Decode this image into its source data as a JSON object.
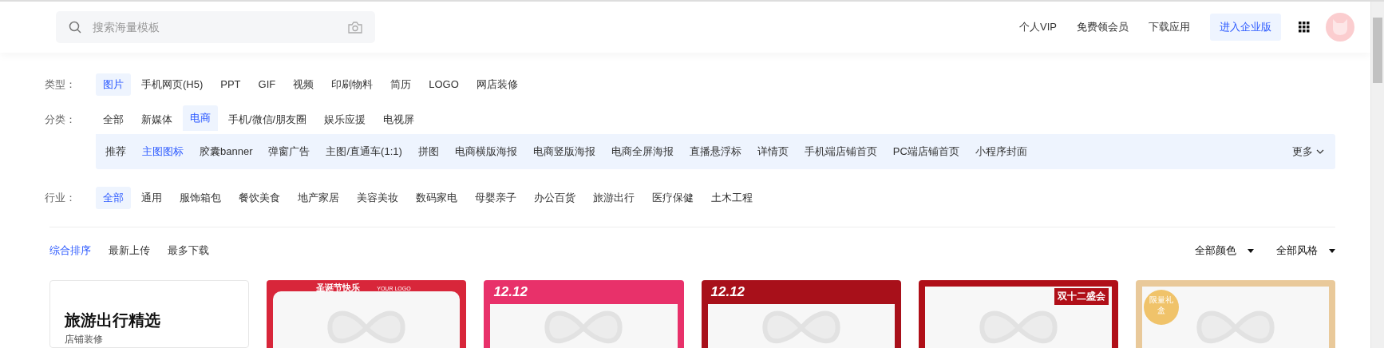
{
  "search": {
    "placeholder": "搜索海量模板"
  },
  "nav_links": [
    "个人VIP",
    "免费领会员",
    "下载应用"
  ],
  "enterprise_button": "进入企业版",
  "filters": [
    {
      "label": "类型：",
      "options": [
        {
          "text": "图片",
          "selected": true
        },
        {
          "text": "手机网页(H5)",
          "selected": false
        },
        {
          "text": "PPT",
          "selected": false
        },
        {
          "text": "GIF",
          "selected": false
        },
        {
          "text": "视频",
          "selected": false
        },
        {
          "text": "印刷物料",
          "selected": false
        },
        {
          "text": "简历",
          "selected": false
        },
        {
          "text": "LOGO",
          "selected": false
        },
        {
          "text": "网店装修",
          "selected": false
        }
      ]
    },
    {
      "label": "分类：",
      "options": [
        {
          "text": "全部",
          "selected": false
        },
        {
          "text": "新媒体",
          "selected": false
        },
        {
          "text": "电商",
          "selected": true
        },
        {
          "text": "手机/微信/朋友圈",
          "selected": false
        },
        {
          "text": "娱乐应援",
          "selected": false
        },
        {
          "text": "电视屏",
          "selected": false
        }
      ],
      "sub_options": [
        {
          "text": "推荐",
          "selected": false
        },
        {
          "text": "主图图标",
          "selected": true
        },
        {
          "text": "胶囊banner",
          "selected": false
        },
        {
          "text": "弹窗广告",
          "selected": false
        },
        {
          "text": "主图/直通车(1:1)",
          "selected": false
        },
        {
          "text": "拼图",
          "selected": false
        },
        {
          "text": "电商横版海报",
          "selected": false
        },
        {
          "text": "电商竖版海报",
          "selected": false
        },
        {
          "text": "电商全屏海报",
          "selected": false
        },
        {
          "text": "直播悬浮标",
          "selected": false
        },
        {
          "text": "详情页",
          "selected": false
        },
        {
          "text": "手机端店铺首页",
          "selected": false
        },
        {
          "text": "PC端店铺首页",
          "selected": false
        },
        {
          "text": "小程序封面",
          "selected": false
        }
      ],
      "more": "更多"
    },
    {
      "label": "行业：",
      "options": [
        {
          "text": "全部",
          "selected": true
        },
        {
          "text": "通用",
          "selected": false
        },
        {
          "text": "服饰箱包",
          "selected": false
        },
        {
          "text": "餐饮美食",
          "selected": false
        },
        {
          "text": "地产家居",
          "selected": false
        },
        {
          "text": "美容美妆",
          "selected": false
        },
        {
          "text": "数码家电",
          "selected": false
        },
        {
          "text": "母婴亲子",
          "selected": false
        },
        {
          "text": "办公百货",
          "selected": false
        },
        {
          "text": "旅游出行",
          "selected": false
        },
        {
          "text": "医疗保健",
          "selected": false
        },
        {
          "text": "土木工程",
          "selected": false
        }
      ]
    }
  ],
  "sort_tabs": [
    {
      "text": "综合排序",
      "selected": true
    },
    {
      "text": "最新上传",
      "selected": false
    },
    {
      "text": "最多下载",
      "selected": false
    }
  ],
  "dropdowns": [
    "全部颜色",
    "全部风格"
  ],
  "feature_card": {
    "title": "旅游出行精选",
    "subtitle": "店铺装修"
  },
  "templates": [
    {
      "kind": "ribbon",
      "color": "#d8263a",
      "text": "圣诞节快乐",
      "logo": "YOUR LOGO"
    },
    {
      "kind": "tab",
      "color": "#e8316a",
      "text": "12.12"
    },
    {
      "kind": "tab",
      "color": "#a8101a",
      "text": "12.12"
    },
    {
      "kind": "corner",
      "color": "#b00f18",
      "text": "双十二盛会"
    },
    {
      "kind": "gold",
      "color": "#e9c99a",
      "text": "限量礼盒"
    }
  ]
}
